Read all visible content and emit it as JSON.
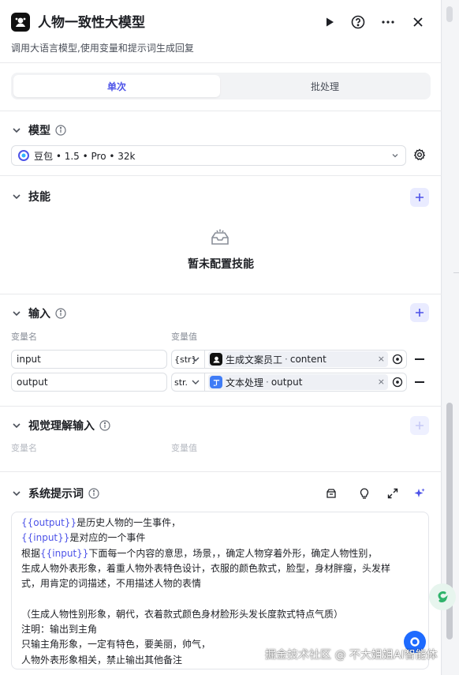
{
  "header": {
    "title": "人物一致性大模型",
    "subtitle": "调用大语言模型,使用变量和提示词生成回复"
  },
  "tabs": [
    {
      "label": "单次",
      "active": true
    },
    {
      "label": "批处理",
      "active": false
    }
  ],
  "model_section": {
    "title": "模型",
    "selected_model": "豆包 • 1.5 • Pro • 32k"
  },
  "skills_section": {
    "title": "技能",
    "empty_text": "暂未配置技能"
  },
  "input_section": {
    "title": "输入",
    "col_name": "变量名",
    "col_value": "变量值",
    "rows": [
      {
        "name": "input",
        "type": "{str}",
        "ref_node": "生成文案员工",
        "ref_field": "content"
      },
      {
        "name": "output",
        "type": "str.",
        "ref_node": "文本处理",
        "ref_field": "output"
      }
    ]
  },
  "visual_section": {
    "title": "视觉理解输入",
    "col_name": "变量名",
    "col_value": "变量值"
  },
  "system_prompt": {
    "title": "系统提示词",
    "lines": [
      {
        "var": "{{output}}",
        "text": "是历史人物的一生事件，"
      },
      {
        "var": "{{input}}",
        "text": "是对应的一个事件"
      },
      {
        "pre": "根据",
        "var": "{{input}}",
        "text": "下面每一个内容的意思，场景，，确定人物穿着外形，确定人物性别，"
      },
      {
        "text": "生成人物外表形象，着重人物外表特色设计，衣服的颜色款式，脸型，身材胖瘦，头发样"
      },
      {
        "text": "式，用肯定的词描述，不用描述人物的表情"
      },
      {
        "text": ""
      },
      {
        "text": "（生成人物性别形象，朝代，衣着款式颜色身材脸形头发长度款式特点气质）"
      },
      {
        "text": "注明：输出到主角"
      },
      {
        "text": "只输主角形象，一定有特色，要美丽，帅气，"
      },
      {
        "text": "人物外表形象相关，禁止输出其他备注"
      }
    ]
  },
  "watermark": "掘金技术社区 @ 不大姐姐AI智能体",
  "colors": {
    "accent": "#4d53e8",
    "accent_bg": "#e9ebff"
  }
}
